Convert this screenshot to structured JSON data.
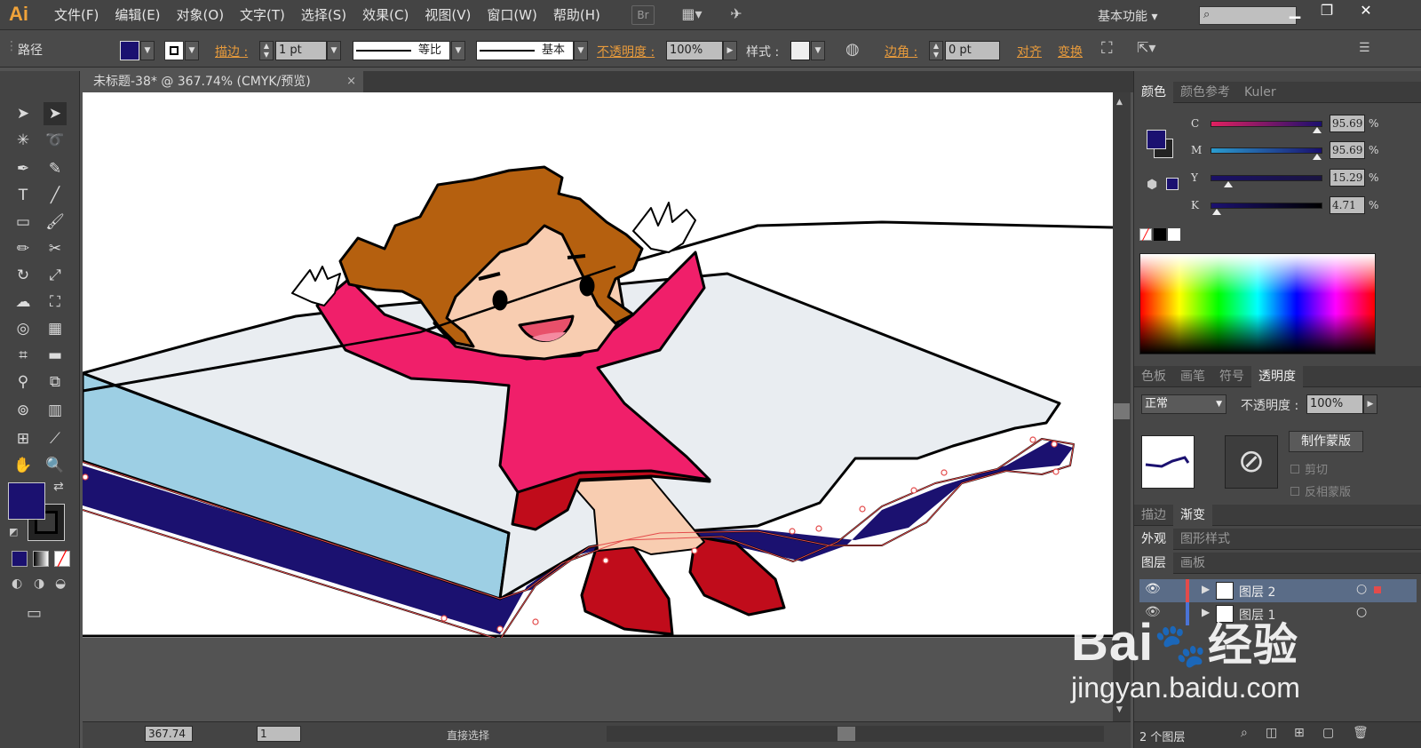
{
  "app": {
    "logo": "Ai",
    "br": "Br",
    "workspace": "基本功能"
  },
  "menu": [
    "文件(F)",
    "编辑(E)",
    "对象(O)",
    "文字(T)",
    "选择(S)",
    "效果(C)",
    "视图(V)",
    "窗口(W)",
    "帮助(H)"
  ],
  "control": {
    "selection_type": "路径",
    "stroke_label": "描边 :",
    "stroke_weight": "1 pt",
    "profile_label": "等比",
    "brush_label": "基本",
    "opacity_label": "不透明度 :",
    "opacity_value": "100%",
    "style_label": "样式 :",
    "corner_label": "边角 :",
    "corner_value": "0 pt",
    "align_label": "对齐",
    "transform_label": "变换"
  },
  "document": {
    "tab_title": "未标题-38* @ 367.74% (CMYK/预览)",
    "close": "×"
  },
  "status": {
    "zoom": "367.74",
    "page": "1",
    "tool": "直接选择"
  },
  "color_panel": {
    "tabs": [
      "颜色",
      "颜色参考",
      "Kuler"
    ],
    "channels": [
      {
        "name": "C",
        "value": "95.69",
        "fraction": 0.96,
        "gradient": "linear-gradient(90deg,#e02060,#1a0f6e)"
      },
      {
        "name": "M",
        "value": "95.69",
        "fraction": 0.96,
        "gradient": "linear-gradient(90deg,#2a9ccf,#1a0f6e)"
      },
      {
        "name": "Y",
        "value": "15.29",
        "fraction": 0.15,
        "gradient": "linear-gradient(90deg,#1a1066,#1a1440)"
      },
      {
        "name": "K",
        "value": "4.71",
        "fraction": 0.05,
        "gradient": "linear-gradient(90deg,#1b1170,#000)"
      }
    ],
    "percent": "%",
    "fill_color": "#1b1170"
  },
  "transparency_panel": {
    "tabs": [
      "色板",
      "画笔",
      "符号",
      "透明度"
    ],
    "blend_mode": "正常",
    "opacity_label": "不透明度 :",
    "opacity_value": "100%",
    "make_mask": "制作蒙版",
    "clip": "剪切",
    "invert_mask": "反相蒙版"
  },
  "stroke_gradient_tabs": [
    "描边",
    "渐变"
  ],
  "appearance_tabs": [
    "外观",
    "图形样式"
  ],
  "layers_panel": {
    "tabs": [
      "图层",
      "画板"
    ],
    "layers": [
      {
        "name": "图层 2",
        "selected": true
      },
      {
        "name": "图层 1",
        "selected": false
      }
    ],
    "count": "2 个图层"
  },
  "watermark": {
    "brand": "Bai",
    "brand2": "经验",
    "url": "jingyan.baidu.com"
  },
  "colors": {
    "accent": "#e89b3c",
    "book_cover": "#1b1170",
    "dress": "#f01f6a",
    "hair": "#b5600f",
    "boots": "#c00c1b"
  }
}
